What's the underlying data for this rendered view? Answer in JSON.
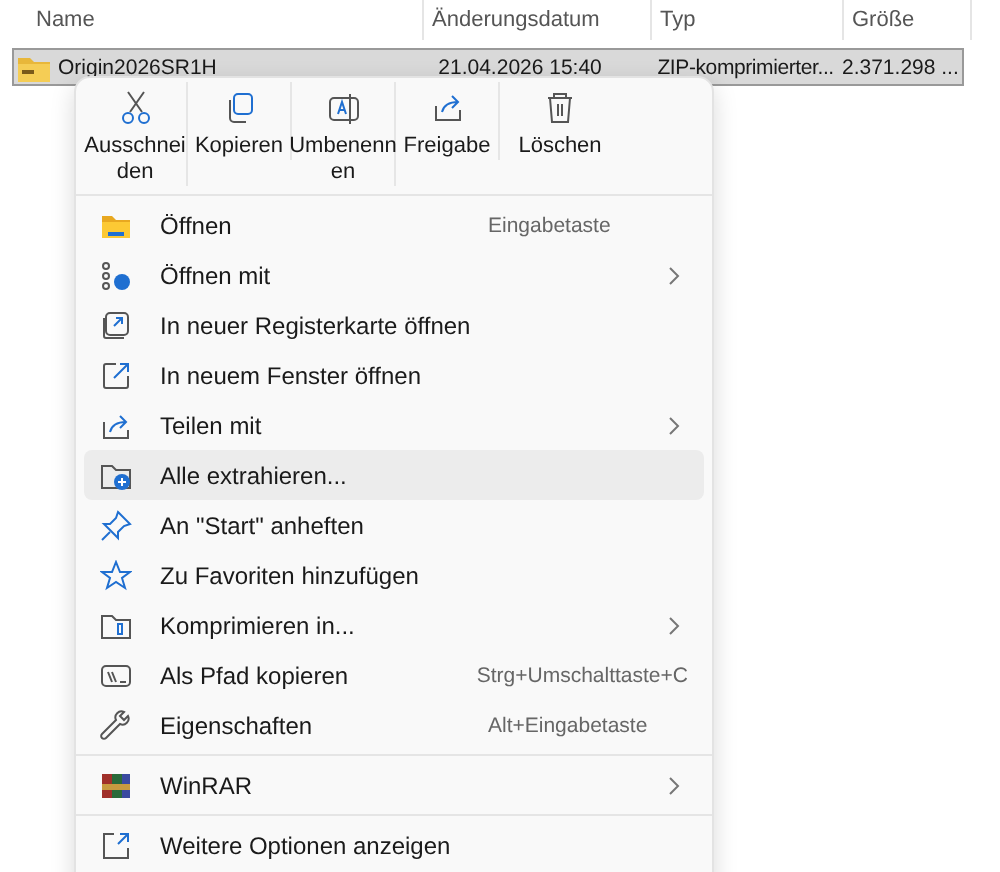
{
  "columns": [
    "Name",
    "Änderungsdatum",
    "Typ",
    "Größe"
  ],
  "file": {
    "name": "Origin2026SR1H",
    "date": "21.04.2026 15:40",
    "type": "ZIP-komprimierter...",
    "size": "2.371.298 ...",
    "selected": true
  },
  "toolbar": [
    {
      "label": "Ausschnei den"
    },
    {
      "label": "Kopieren"
    },
    {
      "label": "Umbenenn en"
    },
    {
      "label": "Freigabe"
    },
    {
      "label": "Löschen"
    }
  ],
  "sections": [
    [
      {
        "label": "Öffnen",
        "shortcut": "Eingabetaste",
        "submenu": false,
        "selected": false
      },
      {
        "label": "Öffnen mit",
        "submenu": true,
        "selected": false
      },
      {
        "label": "In neuer Registerkarte öffnen",
        "submenu": false,
        "selected": false
      },
      {
        "label": "In neuem Fenster öffnen",
        "submenu": false,
        "selected": false
      },
      {
        "label": "Teilen mit",
        "submenu": true,
        "selected": false
      },
      {
        "label": "Alle extrahieren...",
        "submenu": false,
        "selected": true
      },
      {
        "label": "An \"Start\" anheften",
        "submenu": false,
        "selected": false
      },
      {
        "label": "Zu Favoriten hinzufügen",
        "submenu": false,
        "selected": false
      },
      {
        "label": "Komprimieren in...",
        "submenu": true,
        "selected": false
      },
      {
        "label": "Als Pfad kopieren",
        "shortcut": "Strg+Umschalttaste+C",
        "submenu": false,
        "selected": false
      },
      {
        "label": "Eigenschaften",
        "shortcut": "Alt+Eingabetaste",
        "submenu": false,
        "selected": false
      }
    ],
    [
      {
        "label": "WinRAR",
        "submenu": true,
        "selected": false
      }
    ],
    [
      {
        "label": "Weitere Optionen anzeigen",
        "submenu": false,
        "selected": false
      }
    ]
  ]
}
